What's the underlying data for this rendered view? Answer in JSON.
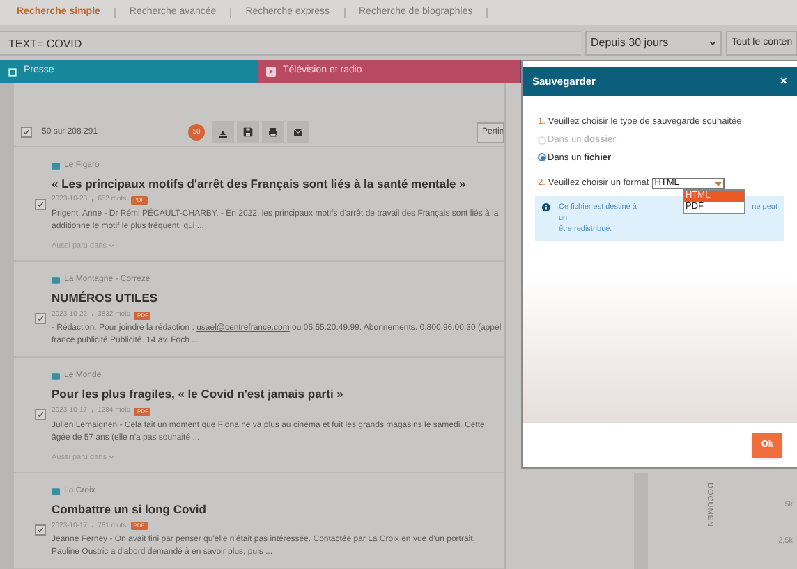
{
  "tabs": [
    {
      "label": "Recherche simple",
      "selected": true
    },
    {
      "label": "Recherche avancée",
      "selected": false
    },
    {
      "label": "Recherche express",
      "selected": false
    },
    {
      "label": "Recherche de biographies",
      "selected": false
    }
  ],
  "search": {
    "value": "TEXT= COVID"
  },
  "filters": [
    {
      "value": "Depuis 30 jours"
    },
    {
      "value": "Tout le conten"
    }
  ],
  "categories": [
    {
      "label": "Presse",
      "color": "#17879c"
    },
    {
      "label": "Télévision et radio",
      "color": "#b84b61"
    }
  ],
  "toolbar": {
    "select_all_checked": true,
    "count": "50 sur 208 291",
    "badge": "50",
    "sort": "Pertin"
  },
  "results": [
    {
      "source": "Le Figaro",
      "title": "« Les principaux motifs d'arrêt des Français sont liés à la santé mentale »",
      "date": "2023-10-23",
      "words": "652 mots",
      "badge": "PDF",
      "snippet": "Prigent, Anne - Dr Rémi PÉCAULT-CHARBY. - En 2022, les principaux motifs d'arrêt de travail des Français sont liés à la additionne le motif le plus fréquent, qui ...",
      "also": "Aussi paru dans",
      "checked": true
    },
    {
      "source": "La Montagne - Corrèze",
      "title": "NUMÉROS UTILES",
      "date": "2023-10-22",
      "words": "3832 mots",
      "badge": "PDF",
      "snippet": "- Rédaction. Pour joindre la rédaction : **usael@centrefrance.com** ou 05.55.20.49.99. Abonnements. 0.800.96.00.30 (appel france publicité Publicité. 14 av. Foch ...",
      "checked": true
    },
    {
      "source": "Le Monde",
      "title": "Pour les plus fragiles, « le Covid n'est jamais parti »",
      "date": "2023-10-17",
      "words": "1284 mots",
      "badge": "PDF",
      "snippet": "Julien Lemaignen - Cela fait un moment que Fiona ne va plus au cinéma et fuit les grands magasins le samedi. Cette âgée de 57 ans (elle n'a pas souhaité ...",
      "also": "Aussi paru dans",
      "checked": true
    },
    {
      "source": "La Croix",
      "title": "Combattre un si long Covid",
      "date": "2023-10-17",
      "words": "761 mots",
      "badge": "PDF",
      "snippet": "Jeanne Ferney - On avait fini par penser qu'elle n'était pas intéressée. Contactée par La Croix en vue d'un portrait, Pauline Oustric a d'abord demandé à en savoir plus, puis ...",
      "checked": true
    }
  ],
  "chart": {
    "axis_title": "DOCUMEN",
    "ticks": [
      "5k",
      "2,5k"
    ]
  },
  "dialog": {
    "title": "Sauvegarder",
    "close": "×",
    "step1": {
      "number": "1.",
      "label": "Veuillez choisir le type de sauvegarde souhaitée"
    },
    "options": [
      {
        "label": "Dans un **dossier**",
        "disabled": true,
        "selected": false
      },
      {
        "label": "Dans un **fichier**",
        "disabled": false,
        "selected": true
      }
    ],
    "step2": {
      "number": "2.",
      "label": "Veuillez choisir un format"
    },
    "format": {
      "value": "HTML",
      "options": [
        {
          "label": "HTML",
          "selected": true
        },
        {
          "label": "PDF",
          "selected": false
        }
      ]
    },
    "info": {
      "before": "Ce fichier est destiné à un",
      "after": "ne peut",
      "line2": "être redistribué."
    },
    "ok": "Ok"
  }
}
